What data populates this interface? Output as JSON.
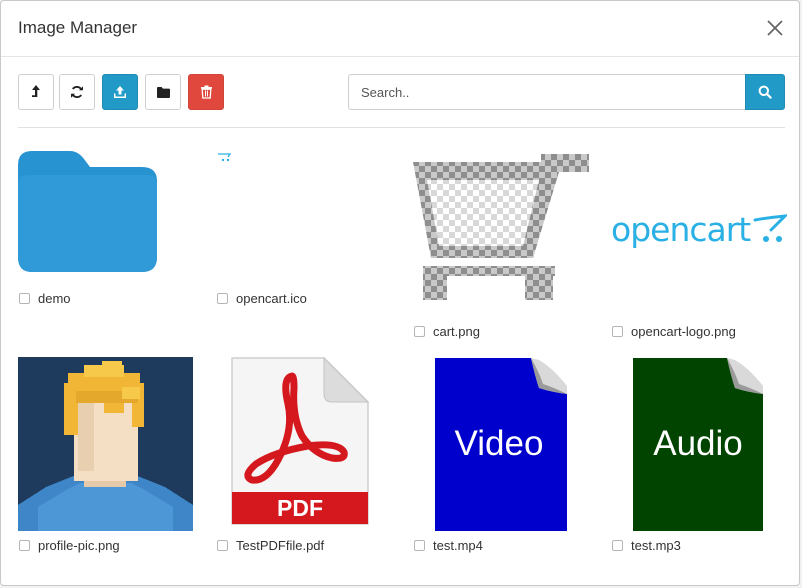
{
  "modal": {
    "title": "Image Manager"
  },
  "toolbar": {
    "buttons": [
      {
        "name": "parent-directory",
        "icon": "level-up-icon"
      },
      {
        "name": "refresh",
        "icon": "refresh-icon"
      },
      {
        "name": "upload",
        "icon": "upload-icon"
      },
      {
        "name": "new-folder",
        "icon": "folder-icon"
      },
      {
        "name": "delete",
        "icon": "trash-icon"
      }
    ],
    "search_placeholder": "Search..",
    "search_icon": "search-icon"
  },
  "colors": {
    "primary": "#229ac8",
    "danger": "#e0483e",
    "folder": "#2893d1",
    "video_bg": "#0000cc",
    "audio_bg": "#004400",
    "logo": "#2ab0e4",
    "pdf_red": "#d4181e"
  },
  "files": [
    {
      "name": "demo",
      "type": "folder"
    },
    {
      "name": "opencart.ico",
      "type": "image"
    },
    {
      "name": "cart.png",
      "type": "image"
    },
    {
      "name": "opencart-logo.png",
      "type": "image",
      "logo_text": "opencart"
    },
    {
      "name": "profile-pic.png",
      "type": "image"
    },
    {
      "name": "TestPDFfile.pdf",
      "type": "pdf",
      "thumb_text": "PDF"
    },
    {
      "name": "test.mp4",
      "type": "video",
      "thumb_text": "Video"
    },
    {
      "name": "test.mp3",
      "type": "audio",
      "thumb_text": "Audio"
    }
  ]
}
